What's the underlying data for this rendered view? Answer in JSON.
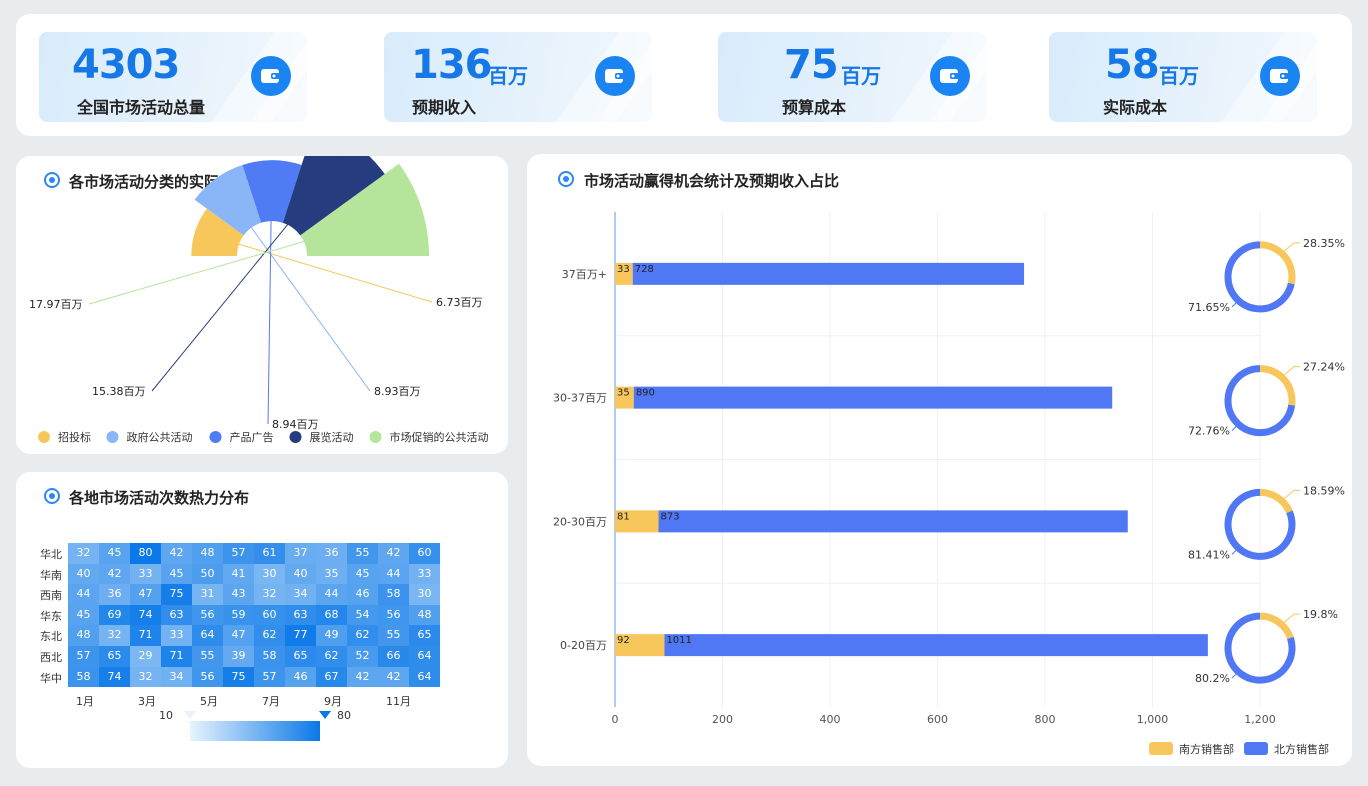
{
  "kpis": [
    {
      "value": "4303",
      "unit": "",
      "label": "全国市场活动总量"
    },
    {
      "value": "136",
      "unit": "百万",
      "label": "预期收入"
    },
    {
      "value": "75",
      "unit": "百万",
      "label": "预算成本"
    },
    {
      "value": "58",
      "unit": "百万",
      "label": "实际成本"
    }
  ],
  "panels": {
    "pie_title": "各市场活动分类的实际成本比较",
    "heat_title": "各地市场活动次数热力分布",
    "bar_title": "市场活动赢得机会统计及预期收入占比"
  },
  "chart_data": [
    {
      "type": "pie",
      "title": "各市场活动分类的实际成本比较",
      "slices": [
        {
          "name": "招投标",
          "value": 6.73,
          "label": "6.73百万",
          "color": "#f7c75c"
        },
        {
          "name": "政府公共活动",
          "value": 8.93,
          "label": "8.93百万",
          "color": "#8ab6f8"
        },
        {
          "name": "产品广告",
          "value": 8.94,
          "label": "8.94百万",
          "color": "#4f7cf5"
        },
        {
          "name": "展览活动",
          "value": 15.38,
          "label": "15.38百万",
          "color": "#253c7e"
        },
        {
          "name": "市场促销的公共活动",
          "value": 17.97,
          "label": "17.97百万",
          "color": "#b4e59a"
        }
      ],
      "legend": "bottom"
    },
    {
      "type": "heatmap",
      "title": "各地市场活动次数热力分布",
      "rows": [
        "华北",
        "华南",
        "西南",
        "华东",
        "东北",
        "西北",
        "华中"
      ],
      "x_tick_labels": [
        "1月",
        "3月",
        "5月",
        "7月",
        "9月",
        "11月"
      ],
      "values": [
        [
          32,
          45,
          80,
          42,
          48,
          57,
          61,
          37,
          36,
          55,
          42,
          60
        ],
        [
          40,
          42,
          33,
          45,
          50,
          41,
          30,
          40,
          35,
          45,
          44,
          33
        ],
        [
          44,
          36,
          47,
          75,
          31,
          43,
          32,
          34,
          44,
          46,
          58,
          30
        ],
        [
          45,
          69,
          74,
          63,
          56,
          59,
          60,
          63,
          68,
          54,
          56,
          48
        ],
        [
          48,
          32,
          71,
          33,
          64,
          47,
          62,
          77,
          49,
          62,
          55,
          65
        ],
        [
          57,
          65,
          29,
          71,
          55,
          39,
          58,
          65,
          62,
          52,
          66,
          64
        ],
        [
          58,
          74,
          32,
          34,
          56,
          75,
          57,
          46,
          67,
          42,
          42,
          64
        ]
      ],
      "scale_min": "10",
      "scale_max": "80",
      "color_low": "#e8f3fd",
      "color_high": "#0a78e8"
    },
    {
      "type": "bar",
      "title": "市场活动赢得机会统计及预期收入占比",
      "orientation": "horizontal",
      "stacked": true,
      "categories": [
        "37百万+",
        "30-37百万",
        "20-30百万",
        "0-20百万"
      ],
      "series": [
        {
          "name": "南方销售部",
          "values": [
            33,
            35,
            81,
            92
          ],
          "color": "#f7c75c"
        },
        {
          "name": "北方销售部",
          "values": [
            728,
            890,
            873,
            1011
          ],
          "color": "#5078f5"
        }
      ],
      "x_ticks": [
        "0",
        "200",
        "400",
        "600",
        "800",
        "1,000",
        "1,200"
      ],
      "xlim": [
        0,
        1200
      ],
      "grid": true,
      "legend": "bottom-right"
    },
    {
      "type": "pie",
      "subtype": "donut",
      "rings": [
        {
          "slices": [
            {
              "value": 28.35,
              "label": "28.35%"
            },
            {
              "value": 71.65,
              "label": "71.65%"
            }
          ]
        },
        {
          "slices": [
            {
              "value": 27.24,
              "label": "27.24%"
            },
            {
              "value": 72.76,
              "label": "72.76%"
            }
          ]
        },
        {
          "slices": [
            {
              "value": 18.59,
              "label": "18.59%"
            },
            {
              "value": 81.41,
              "label": "81.41%"
            }
          ]
        },
        {
          "slices": [
            {
              "value": 19.8,
              "label": "19.8%"
            },
            {
              "value": 80.2,
              "label": "80.2%"
            }
          ]
        }
      ],
      "colors": [
        "#f7c75c",
        "#5078f5"
      ]
    }
  ],
  "icons": {
    "kpi": "wallet-icon",
    "panel": "target-dot-icon"
  }
}
